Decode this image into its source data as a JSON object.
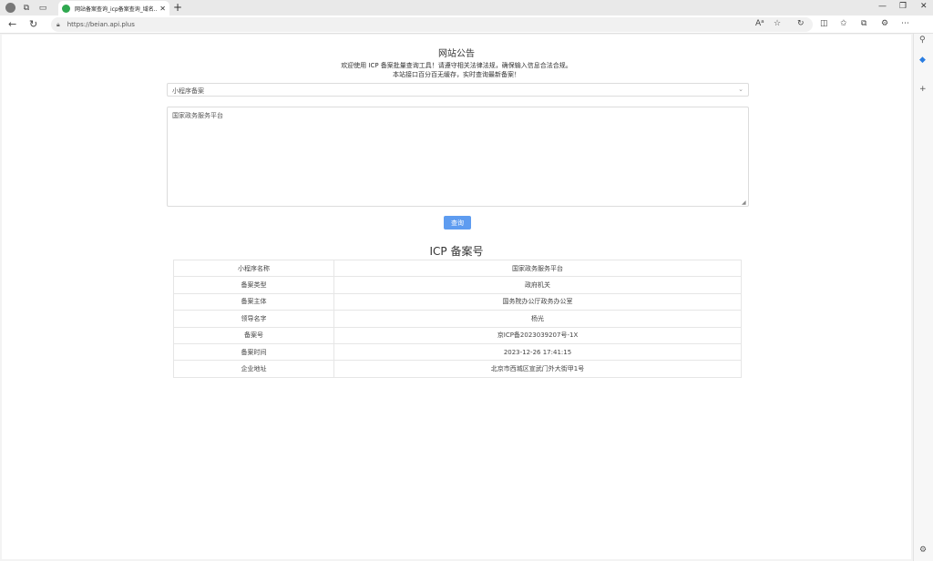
{
  "browser": {
    "tab_title": "网站备案查询_icp备案查询_域名...",
    "url": "https://beian.api.plus",
    "colors": {
      "favicon": "#2fa84f"
    }
  },
  "notice": {
    "title": "网站公告",
    "line1": "欢迎使用 ICP 备案批量查询工具！请遵守相关法律法规，确保输入信息合法合规。",
    "line2": "本站接口百分百无缓存，实时查询最新备案！"
  },
  "form": {
    "select_value": "小程序备案",
    "textarea_value": "国家政务服务平台",
    "query_label": "查询",
    "colors": {
      "button": "#5e9cf0"
    }
  },
  "result": {
    "title": "ICP 备案号",
    "rows": [
      {
        "label": "小程序名称",
        "value": "国家政务服务平台"
      },
      {
        "label": "备案类型",
        "value": "政府机关"
      },
      {
        "label": "备案主体",
        "value": "国务院办公厅政务办公室"
      },
      {
        "label": "领导名字",
        "value": "杨光"
      },
      {
        "label": "备案号",
        "value": "京ICP备2023039207号-1X"
      },
      {
        "label": "备案时间",
        "value": "2023-12-26 17:41:15"
      },
      {
        "label": "企业地址",
        "value": "北京市西城区宣武门外大街甲1号"
      }
    ]
  }
}
